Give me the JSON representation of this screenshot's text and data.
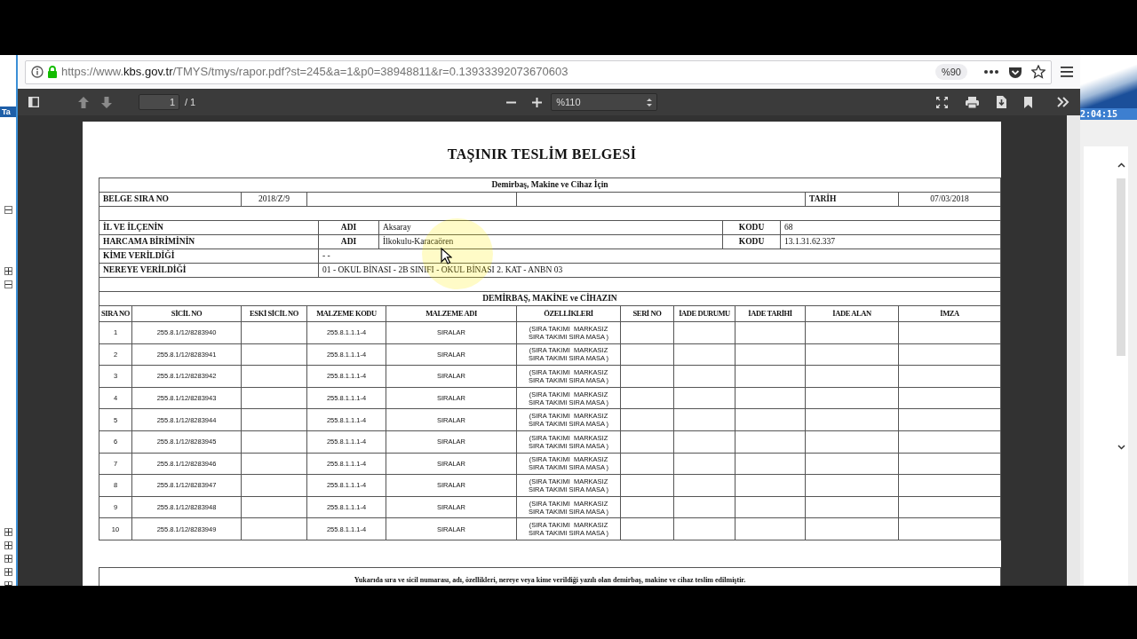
{
  "background_app": {
    "left_text": "Ta",
    "clock": "2:04:15"
  },
  "browser": {
    "url_scheme": "https://www.",
    "url_domain": "kbs.gov.tr",
    "url_path": "/TMYS/tmys/rapor.pdf?st=245&a=1&p0=38948811&r=0.13933392073670603",
    "zoom": "%90"
  },
  "pdf_toolbar": {
    "page": "1",
    "page_count": "/ 1",
    "scale": "%110"
  },
  "document": {
    "title": "TAŞINIR TESLİM BELGESİ",
    "subtitle": "Demirbaş, Makine ve Cihaz İçin",
    "belge": {
      "label": "BELGE SIRA NO",
      "value": "2018/Z/9",
      "date_label": "TARİH",
      "date": "07/03/2018"
    },
    "info_rows": [
      {
        "kind": "coded",
        "label": "İL VE İLÇENİN",
        "name_label": "ADI",
        "value": "Aksaray",
        "code_label": "KODU",
        "code": "68"
      },
      {
        "kind": "coded",
        "label": "HARCAMA BİRİMİNİN",
        "name_label": "ADI",
        "value": "İlkokulu-Karacaören",
        "code_label": "KODU",
        "code": "13.1.31.62.337"
      },
      {
        "kind": "plain",
        "label": "KİME VERİLDİĞİ",
        "value": "- -"
      },
      {
        "kind": "plain",
        "label": "NEREYE VERİLDİĞİ",
        "value": "01 - OKUL BİNASI - 2B SINIFI - OKUL BİNASI 2. KAT - ANBN 03"
      }
    ],
    "section_title": "DEMİRBAŞ, MAKİNE ve CİHAZIN",
    "columns": [
      "SIRA NO",
      "SİCİL NO",
      "ESKİ SİCİL NO",
      "MALZEME KODU",
      "MALZEME ADI",
      "ÖZELLİKLERİ",
      "SERİ NO",
      "İADE DURUMU",
      "İADE TARİHİ",
      "İADE ALAN",
      "İMZA"
    ],
    "rows": [
      {
        "sira_no": "1",
        "sicil_no": "255.8.1/12/8283940",
        "malzeme_kodu": "255.8.1.1.1-4",
        "malzeme_adi": "SIRALAR",
        "ozellikleri": "(SIRA TAKIMI  MARKASIZ\nSIRA TAKIMI SIRA MASA )"
      },
      {
        "sira_no": "2",
        "sicil_no": "255.8.1/12/8283941",
        "malzeme_kodu": "255.8.1.1.1-4",
        "malzeme_adi": "SIRALAR",
        "ozellikleri": "(SIRA TAKIMI  MARKASIZ\nSIRA TAKIMI SIRA MASA )"
      },
      {
        "sira_no": "3",
        "sicil_no": "255.8.1/12/8283942",
        "malzeme_kodu": "255.8.1.1.1-4",
        "malzeme_adi": "SIRALAR",
        "ozellikleri": "(SIRA TAKIMI  MARKASIZ\nSIRA TAKIMI SIRA MASA )"
      },
      {
        "sira_no": "4",
        "sicil_no": "255.8.1/12/8283943",
        "malzeme_kodu": "255.8.1.1.1-4",
        "malzeme_adi": "SIRALAR",
        "ozellikleri": "(SIRA TAKIMI  MARKASIZ\nSIRA TAKIMI SIRA MASA )"
      },
      {
        "sira_no": "5",
        "sicil_no": "255.8.1/12/8283944",
        "malzeme_kodu": "255.8.1.1.1-4",
        "malzeme_adi": "SIRALAR",
        "ozellikleri": "(SIRA TAKIMI  MARKASIZ\nSIRA TAKIMI SIRA MASA )"
      },
      {
        "sira_no": "6",
        "sicil_no": "255.8.1/12/8283945",
        "malzeme_kodu": "255.8.1.1.1-4",
        "malzeme_adi": "SIRALAR",
        "ozellikleri": "(SIRA TAKIMI  MARKASIZ\nSIRA TAKIMI SIRA MASA )"
      },
      {
        "sira_no": "7",
        "sicil_no": "255.8.1/12/8283946",
        "malzeme_kodu": "255.8.1.1.1-4",
        "malzeme_adi": "SIRALAR",
        "ozellikleri": "(SIRA TAKIMI  MARKASIZ\nSIRA TAKIMI SIRA MASA )"
      },
      {
        "sira_no": "8",
        "sicil_no": "255.8.1/12/8283947",
        "malzeme_kodu": "255.8.1.1.1-4",
        "malzeme_adi": "SIRALAR",
        "ozellikleri": "(SIRA TAKIMI  MARKASIZ\nSIRA TAKIMI SIRA MASA )"
      },
      {
        "sira_no": "9",
        "sicil_no": "255.8.1/12/8283948",
        "malzeme_kodu": "255.8.1.1.1-4",
        "malzeme_adi": "SIRALAR",
        "ozellikleri": "(SIRA TAKIMI  MARKASIZ\nSIRA TAKIMI SIRA MASA )"
      },
      {
        "sira_no": "10",
        "sicil_no": "255.8.1/12/8283949",
        "malzeme_kodu": "255.8.1.1.1-4",
        "malzeme_adi": "SIRALAR",
        "ozellikleri": "(SIRA TAKIMI  MARKASIZ\nSIRA TAKIMI SIRA MASA )"
      }
    ],
    "footer_note": "Yukarıda sıra ve sicil numarası, adı, özellikleri, nereye veya kime verildiği yazılı olan demirbaş, makine ve cihaz teslim edilmiştir."
  }
}
